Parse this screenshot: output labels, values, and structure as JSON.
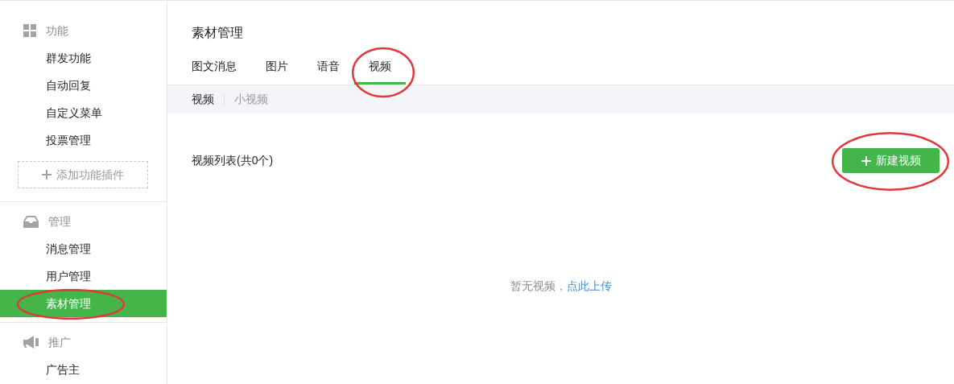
{
  "sidebar": {
    "sections": [
      {
        "kind": "grid",
        "label": "功能",
        "items": [
          {
            "label": "群发功能",
            "selected": false,
            "circled": false
          },
          {
            "label": "自动回复",
            "selected": false,
            "circled": false
          },
          {
            "label": "自定义菜单",
            "selected": false,
            "circled": false
          },
          {
            "label": "投票管理",
            "selected": false,
            "circled": false
          }
        ],
        "add_button": "添加功能插件"
      },
      {
        "kind": "inbox",
        "label": "管理",
        "items": [
          {
            "label": "消息管理",
            "selected": false,
            "circled": false
          },
          {
            "label": "用户管理",
            "selected": false,
            "circled": false
          },
          {
            "label": "素材管理",
            "selected": true,
            "circled": true
          }
        ]
      },
      {
        "kind": "megaphone",
        "label": "推广",
        "items": [
          {
            "label": "广告主",
            "selected": false,
            "circled": false
          }
        ]
      }
    ]
  },
  "main": {
    "title": "素材管理",
    "tabs": [
      {
        "label": "图文消息",
        "selected": false,
        "circled": false
      },
      {
        "label": "图片",
        "selected": false,
        "circled": false
      },
      {
        "label": "语音",
        "selected": false,
        "circled": false
      },
      {
        "label": "视频",
        "selected": true,
        "circled": true
      }
    ],
    "subtabs": [
      {
        "label": "视频",
        "selected": true
      },
      {
        "label": "小视频",
        "selected": false
      }
    ],
    "list_title": "视频列表(共0个)",
    "new_button": {
      "label": "新建视频",
      "circled": true
    },
    "empty": {
      "text": "暂无视频，",
      "link": "点此上传"
    }
  }
}
